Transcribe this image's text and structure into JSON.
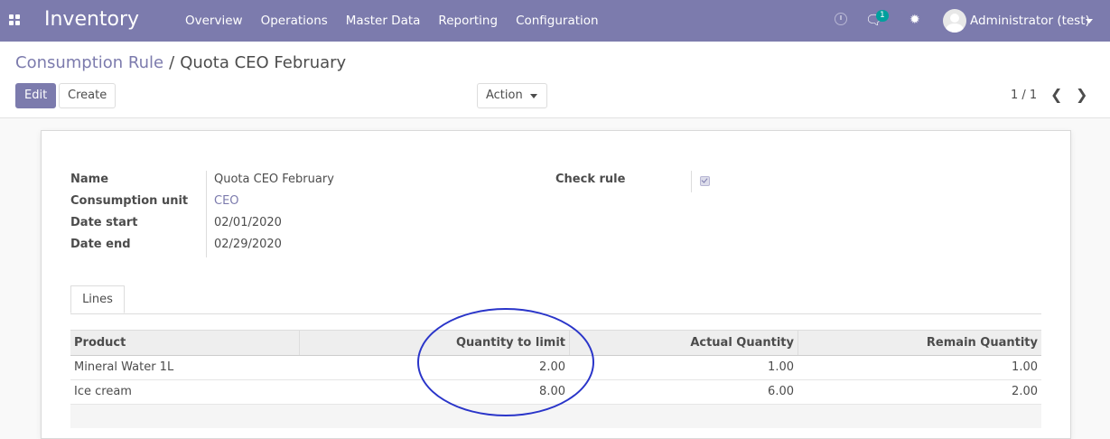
{
  "navbar": {
    "app_name": "Inventory",
    "menu": [
      "Overview",
      "Operations",
      "Master Data",
      "Reporting",
      "Configuration"
    ],
    "chat_badge": "1",
    "user": "Administrator (test)"
  },
  "breadcrumb": {
    "parent": "Consumption Rule",
    "separator": "/",
    "current": "Quota CEO February"
  },
  "buttons": {
    "edit": "Edit",
    "create": "Create",
    "action": "Action"
  },
  "pager": {
    "text": "1 / 1"
  },
  "form": {
    "name_label": "Name",
    "name_value": "Quota CEO February",
    "unit_label": "Consumption unit",
    "unit_value": "CEO",
    "date_start_label": "Date start",
    "date_start_value": "02/01/2020",
    "date_end_label": "Date end",
    "date_end_value": "02/29/2020",
    "check_rule_label": "Check rule",
    "check_rule_checked": true
  },
  "tabs": [
    "Lines"
  ],
  "table": {
    "headers": [
      "Product",
      "Quantity to limit",
      "Actual Quantity",
      "Remain Quantity"
    ],
    "rows": [
      [
        "Mineral Water 1L",
        "2.00",
        "1.00",
        "1.00"
      ],
      [
        "Ice cream",
        "8.00",
        "6.00",
        "2.00"
      ]
    ]
  },
  "colors": {
    "brand": "#7c7bad",
    "annotation": "#2a35c9"
  }
}
